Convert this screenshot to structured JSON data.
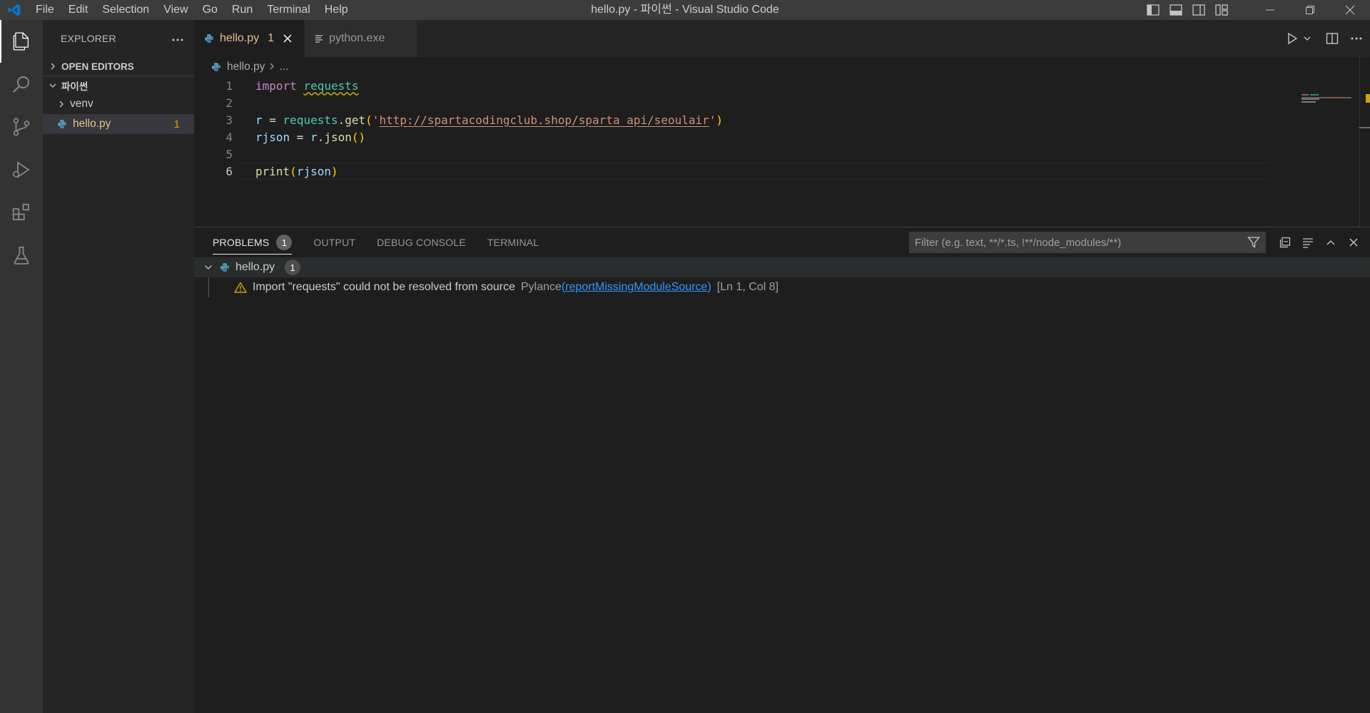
{
  "window": {
    "title": "hello.py - 파이썬 - Visual Studio Code",
    "menu": [
      "File",
      "Edit",
      "Selection",
      "View",
      "Go",
      "Run",
      "Terminal",
      "Help"
    ]
  },
  "activity_bar": {
    "items": [
      "explorer-icon",
      "search-icon",
      "source-control-icon",
      "run-debug-icon",
      "extensions-icon",
      "testing-icon"
    ]
  },
  "sidebar": {
    "title": "EXPLORER",
    "open_editors": "OPEN EDITORS",
    "folder": "파이썬",
    "items": [
      {
        "label": "venv",
        "type": "folder"
      },
      {
        "label": "hello.py",
        "type": "file",
        "problems": "1"
      }
    ]
  },
  "editor": {
    "tabs": [
      {
        "label": "hello.py",
        "problems": "1",
        "active": true
      },
      {
        "label": "python.exe",
        "active": false
      }
    ],
    "breadcrumb": {
      "file": "hello.py",
      "rest": "..."
    },
    "line_numbers": [
      "1",
      "2",
      "3",
      "4",
      "5",
      "6"
    ],
    "code": {
      "l1_kw": "import",
      "l1_mod": "requests",
      "l3_var": "r",
      "l3_eq": " = ",
      "l3_obj": "requests",
      "l3_dot": ".",
      "l3_fn": "get",
      "l3_open": "(",
      "l3_q1": "'",
      "l3_url": "http://spartacodingclub.shop/sparta_api/seoulair",
      "l3_q2": "'",
      "l3_close": ")",
      "l4_var": "rjson",
      "l4_eq": " = ",
      "l4_obj": "r",
      "l4_dot": ".",
      "l4_fn": "json",
      "l4_paren": "()",
      "l6_fn": "print",
      "l6_open": "(",
      "l6_arg": "rjson",
      "l6_close": ")"
    }
  },
  "panel": {
    "tabs": [
      {
        "label": "PROBLEMS",
        "badge": "1",
        "active": true
      },
      {
        "label": "OUTPUT"
      },
      {
        "label": "DEBUG CONSOLE"
      },
      {
        "label": "TERMINAL"
      }
    ],
    "filter_placeholder": "Filter (e.g. text, **/*.ts, !**/node_modules/**)",
    "problem_file": {
      "name": "hello.py",
      "count": "1"
    },
    "problem": {
      "message": "Import \"requests\" could not be resolved from source",
      "source": "Pylance",
      "code_open": "(",
      "code": "reportMissingModuleSource",
      "code_close": ")",
      "position": "[Ln 1, Col 8]"
    }
  },
  "colors": {
    "warning": "#cca700",
    "accent_link": "#3794ff",
    "vscode_blue": "#0078d4"
  }
}
